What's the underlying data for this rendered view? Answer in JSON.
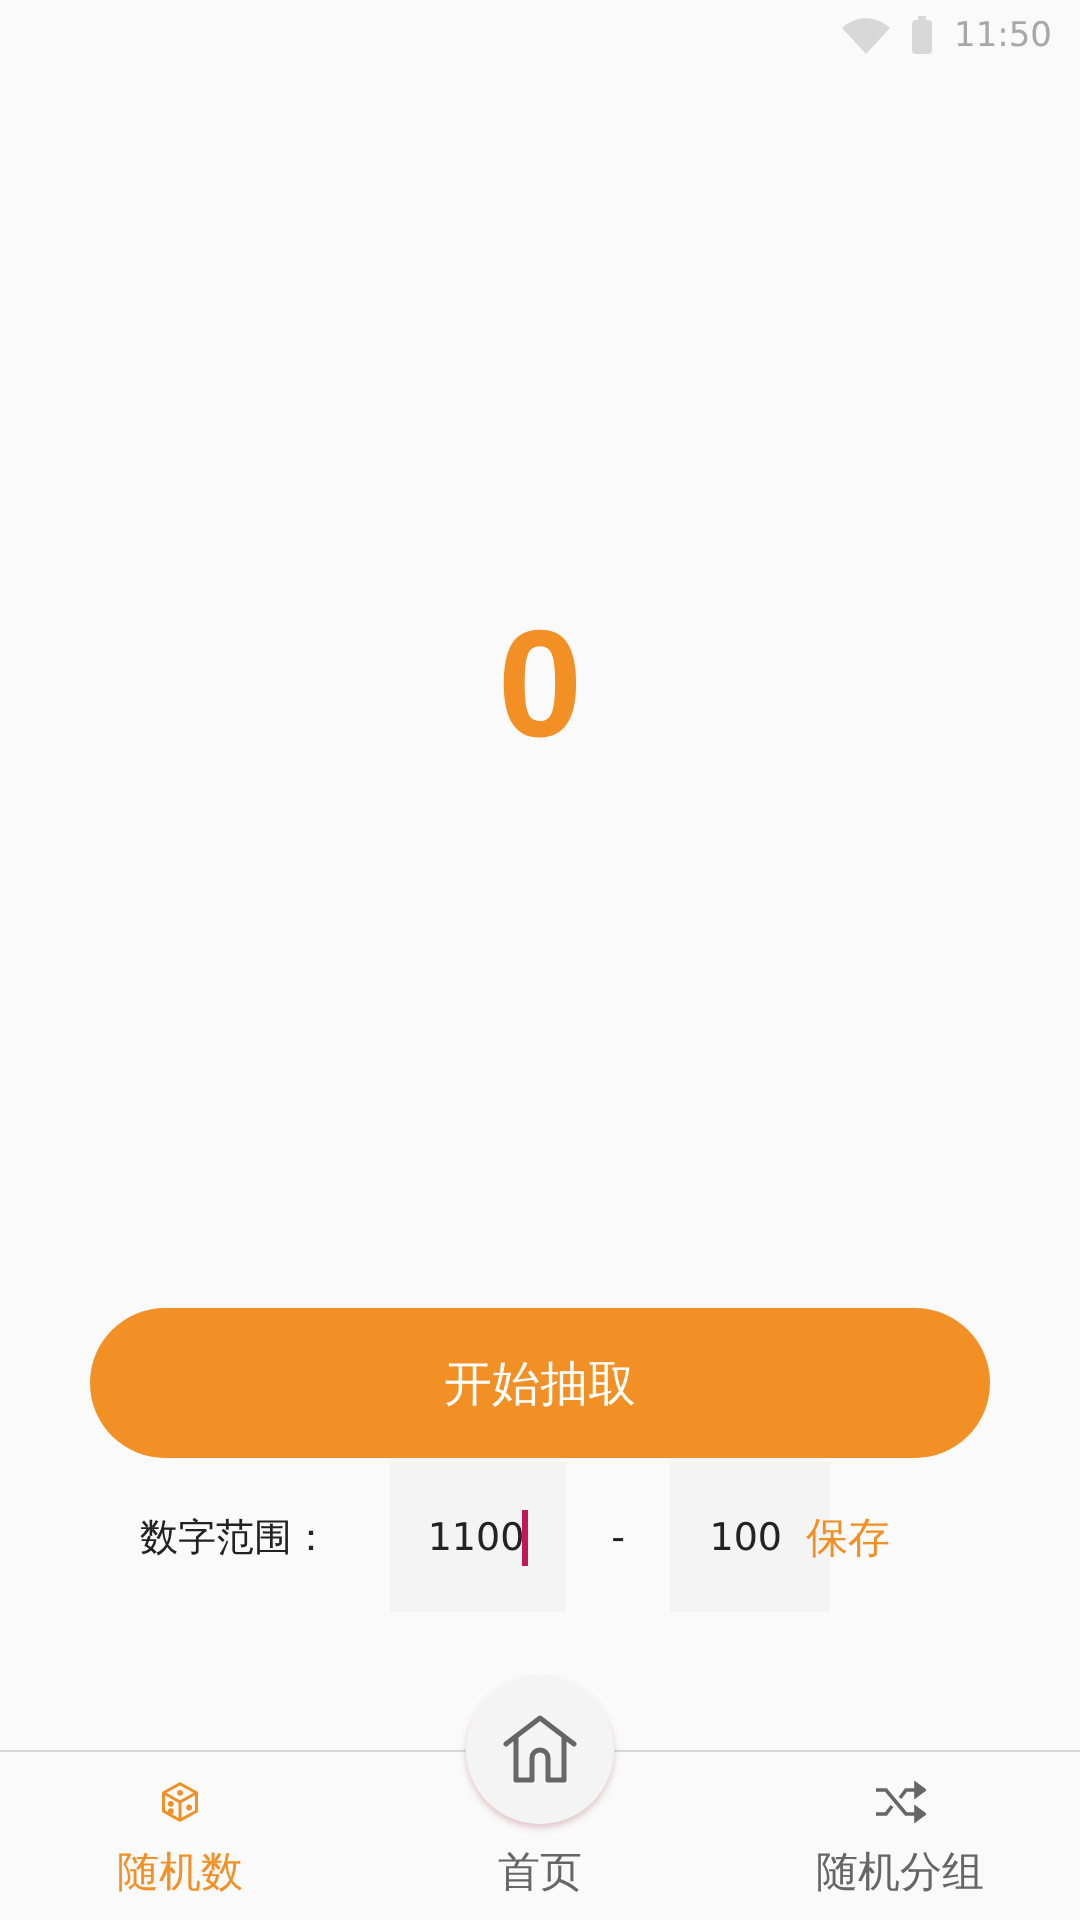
{
  "status_bar": {
    "time": "11:50"
  },
  "result": {
    "value": "0"
  },
  "draw_button": {
    "label": "开始抽取"
  },
  "range": {
    "label": "数字范围：",
    "min": {
      "value": "1100",
      "focused": true
    },
    "separator": "-",
    "max": {
      "value": "100",
      "focused": false
    },
    "save": "保存"
  },
  "bottom_nav": [
    {
      "label": "随机数",
      "selected": true,
      "kind": "tab"
    },
    {
      "label": "首页",
      "selected": false,
      "kind": "fab"
    },
    {
      "label": "随机分组",
      "selected": false,
      "kind": "tab"
    }
  ]
}
